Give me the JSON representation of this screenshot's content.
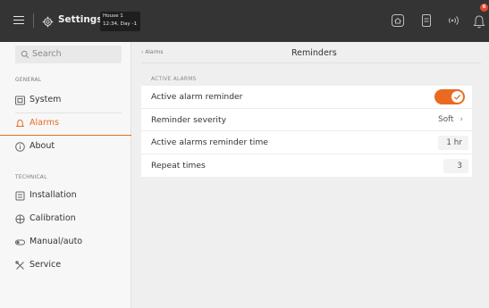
{
  "topbar": {
    "title": "Settings",
    "house_name": "House 1",
    "house_time": "12:34, Day -1",
    "notification_count": "6",
    "colors": {
      "bar": "#343434",
      "badge": "#e84a2f"
    },
    "icons": [
      "menu-icon",
      "gear-icon",
      "home-icon",
      "tablet-icon",
      "wireless-icon",
      "bell-icon"
    ]
  },
  "sidebar": {
    "search_placeholder": "Search",
    "general_heading": "GENERAL",
    "technical_heading": "TECHNICAL",
    "general_items": [
      {
        "label": "System",
        "icon": "system-icon"
      },
      {
        "label": "Alarms",
        "icon": "bell-icon",
        "active": true
      },
      {
        "label": "About",
        "icon": "info-icon"
      }
    ],
    "technical_items": [
      {
        "label": "Installation",
        "icon": "installation-icon"
      },
      {
        "label": "Calibration",
        "icon": "calibration-icon"
      },
      {
        "label": "Manual/auto",
        "icon": "toggle-icon"
      },
      {
        "label": "Service",
        "icon": "tools-icon"
      }
    ],
    "accent_color": "#ea6b1f"
  },
  "main": {
    "back_label": "Alarms",
    "title": "Reminders",
    "section_label": "ACTIVE ALARMS",
    "rows": [
      {
        "label": "Active alarm reminder",
        "type": "toggle",
        "on": true
      },
      {
        "label": "Reminder severity",
        "type": "select",
        "value": "Soft"
      },
      {
        "label": "Active alarms reminder time",
        "type": "value",
        "value": "1 hr"
      },
      {
        "label": "Repeat times",
        "type": "value",
        "value": "3"
      }
    ]
  }
}
